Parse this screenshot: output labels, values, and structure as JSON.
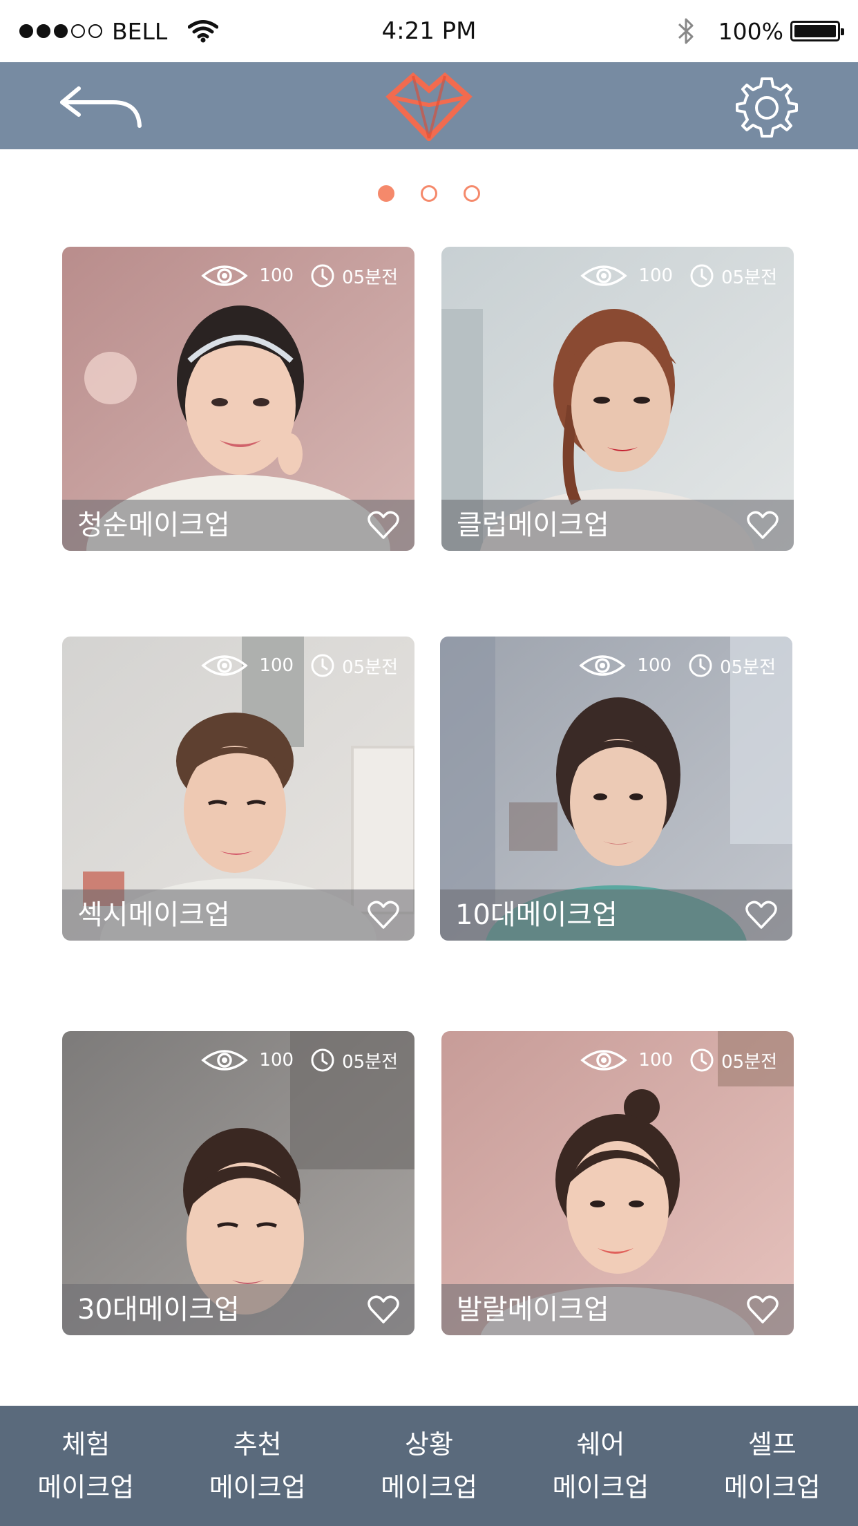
{
  "status_bar": {
    "carrier": "BELL",
    "time": "4:21 PM",
    "battery": "100%",
    "signal_strength": "3 of 5"
  },
  "header": {
    "back_icon": "back-arrow-icon",
    "logo_icon": "heart-logo-icon",
    "settings_icon": "gear-icon",
    "accent_color": "#f26b4f",
    "background_color": "#778ba2"
  },
  "pager": {
    "pages": 3,
    "active_page": 1,
    "color": "#f5896b"
  },
  "cards": [
    {
      "title": "청순메이크업",
      "views": "100",
      "time": "05분전"
    },
    {
      "title": "클럽메이크업",
      "views": "100",
      "time": "05분전"
    },
    {
      "title": "섹시메이크업",
      "views": "100",
      "time": "05분전"
    },
    {
      "title": "10대메이크업",
      "views": "100",
      "time": "05분전"
    },
    {
      "title": "30대메이크업",
      "views": "100",
      "time": "05분전"
    },
    {
      "title": "발랄메이크업",
      "views": "100",
      "time": "05분전"
    }
  ],
  "tabs": [
    {
      "line1": "체험",
      "line2": "메이크업"
    },
    {
      "line1": "추천",
      "line2": "메이크업"
    },
    {
      "line1": "상황",
      "line2": "메이크업"
    },
    {
      "line1": "쉐어",
      "line2": "메이크업"
    },
    {
      "line1": "셀프",
      "line2": "메이크업"
    }
  ],
  "tab_bar_color": "#5a6a7c"
}
